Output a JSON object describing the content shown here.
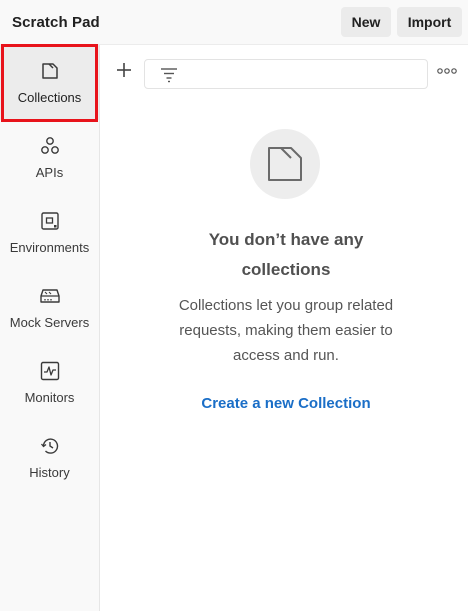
{
  "header": {
    "title": "Scratch Pad",
    "new_label": "New",
    "import_label": "Import"
  },
  "sidebar": {
    "items": [
      {
        "label": "Collections",
        "icon": "collection-icon",
        "active": true
      },
      {
        "label": "APIs",
        "icon": "apis-icon",
        "active": false
      },
      {
        "label": "Environments",
        "icon": "environment-icon",
        "active": false
      },
      {
        "label": "Mock Servers",
        "icon": "mock-server-icon",
        "active": false
      },
      {
        "label": "Monitors",
        "icon": "monitor-icon",
        "active": false
      },
      {
        "label": "History",
        "icon": "history-icon",
        "active": false
      }
    ]
  },
  "empty_state": {
    "title_line1": "You don’t have any",
    "title_line2": "collections",
    "desc_line1": "Collections let you group related",
    "desc_line2": "requests, making them easier to",
    "desc_line3": "access and run.",
    "create_label": "Create a new Collection"
  },
  "colors": {
    "highlight": "#e8131b",
    "link": "#1a6ec7"
  }
}
